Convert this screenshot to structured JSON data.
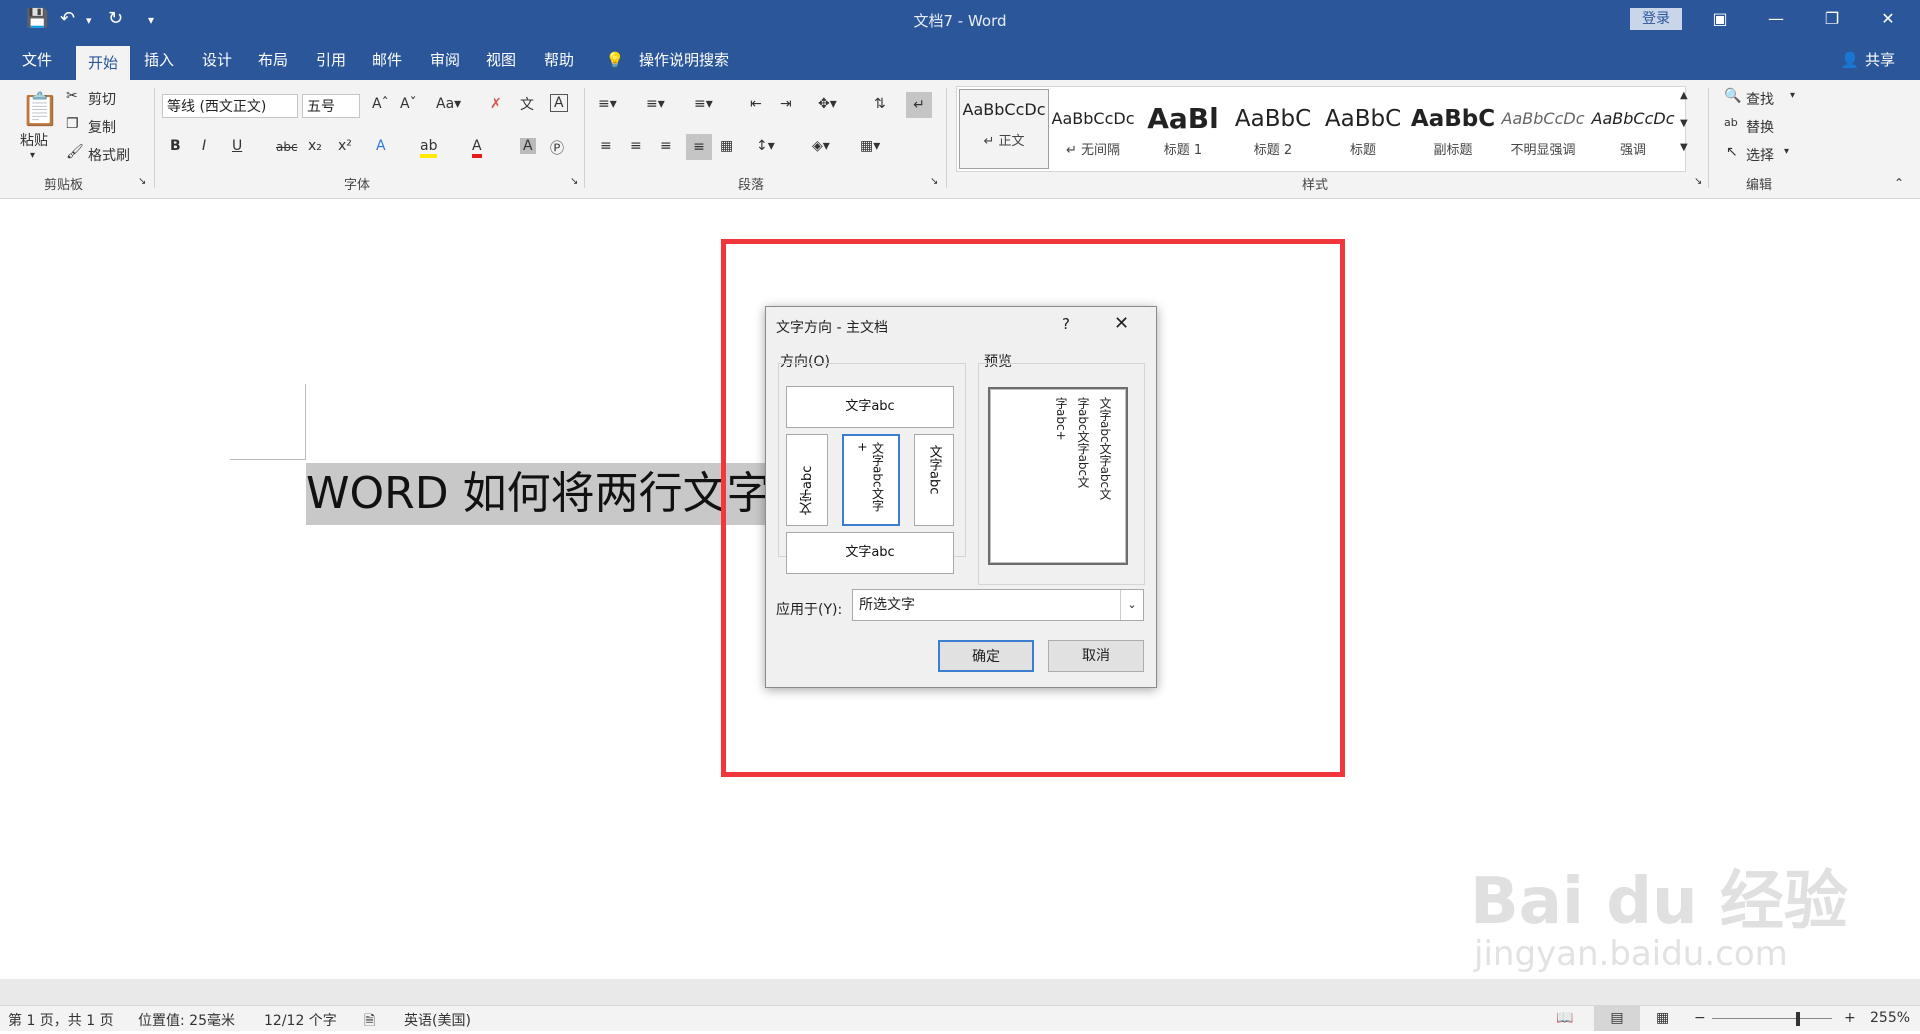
{
  "window": {
    "title": "文档7  -  Word",
    "login": "登录"
  },
  "menu": {
    "tabs": [
      "文件",
      "开始",
      "插入",
      "设计",
      "布局",
      "引用",
      "邮件",
      "审阅",
      "视图",
      "帮助"
    ],
    "search": "操作说明搜索",
    "share": "共享"
  },
  "ribbon": {
    "clipboard": {
      "paste": "粘贴",
      "cut": "剪切",
      "copy": "复制",
      "format_painter": "格式刷",
      "label": "剪贴板"
    },
    "font": {
      "name": "等线 (西文正文)",
      "size": "五号",
      "label": "字体"
    },
    "paragraph": {
      "label": "段落"
    },
    "styles": {
      "label": "样式",
      "items": [
        {
          "sample": "AaBbCcDc",
          "name": "正文"
        },
        {
          "sample": "AaBbCcDc",
          "name": "无间隔"
        },
        {
          "sample": "AaBl",
          "name": "标题 1"
        },
        {
          "sample": "AaBbC",
          "name": "标题 2"
        },
        {
          "sample": "AaBbC",
          "name": "标题"
        },
        {
          "sample": "AaBbC",
          "name": "副标题"
        },
        {
          "sample": "AaBbCcDc",
          "name": "不明显强调"
        },
        {
          "sample": "AaBbCcDc",
          "name": "强调"
        }
      ]
    },
    "editing": {
      "find": "查找",
      "replace": "替换",
      "select": "选择",
      "label": "编辑"
    }
  },
  "document": {
    "text": "WORD 如何将两行文字"
  },
  "dialog": {
    "title": "文字方向 - 主文档",
    "help": "?",
    "orientation_label": "方向(O)",
    "preview_label": "预览",
    "options": {
      "horizontal": "文字abc",
      "vertical_left": "文字abc",
      "vertical_center": "文字abc文字+",
      "vertical_right": "文字abc",
      "bottom": "文字abc"
    },
    "preview_lines": [
      "文字abc文字abc文",
      "字abc文字abc文",
      "字abc+"
    ],
    "apply_label": "应用于(Y):",
    "apply_value": "所选文字",
    "ok": "确定",
    "cancel": "取消"
  },
  "status": {
    "page": "第 1 页，共 1 页",
    "position": "位置值: 25毫米",
    "words": "12/12 个字",
    "language": "英语(美国)",
    "zoom": "255%"
  },
  "watermark": {
    "brand": "Bai du 经验",
    "url": "jingyan.baidu.com"
  }
}
